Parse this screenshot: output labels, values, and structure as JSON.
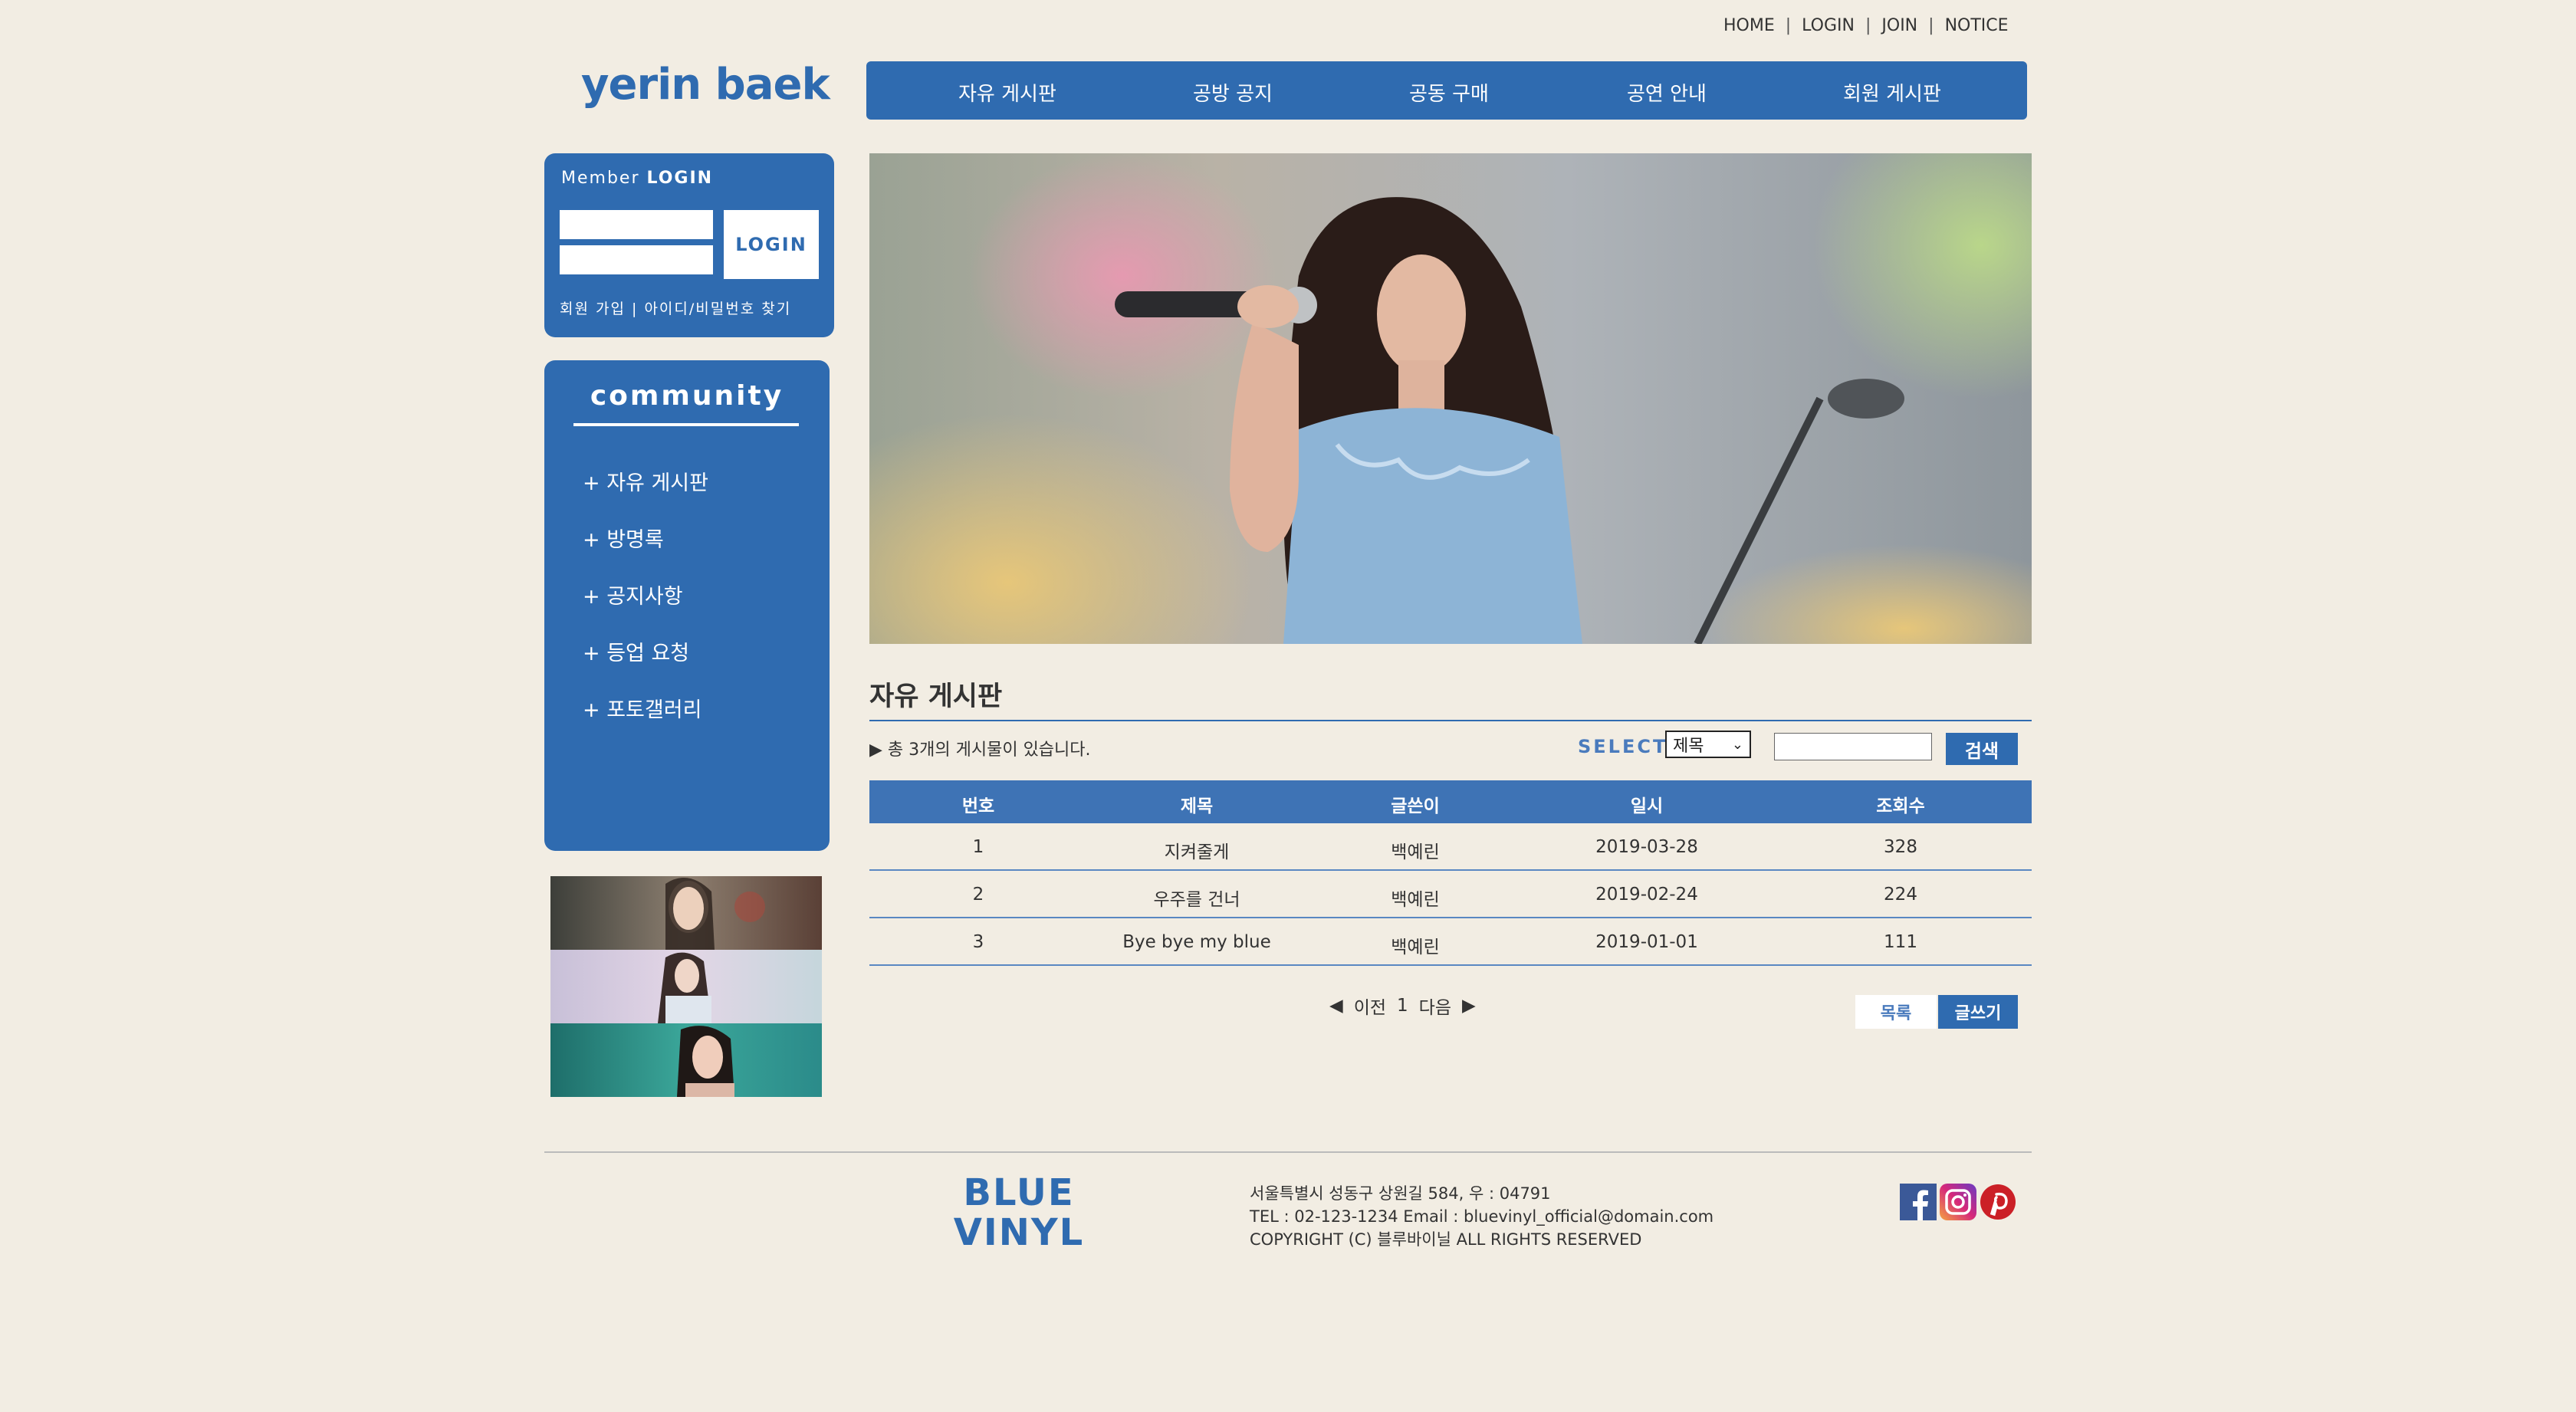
{
  "top_links": [
    "HOME",
    "LOGIN",
    "JOIN",
    "NOTICE"
  ],
  "logo": "yerin baek",
  "nav": [
    "자유 게시판",
    "공방 공지",
    "공동 구매",
    "공연 안내",
    "회원 게시판"
  ],
  "login": {
    "title_prefix": "Member",
    "title_bold": "LOGIN",
    "button": "LOGIN",
    "links": "회원 가입  |  아이디/비밀번호 찾기"
  },
  "community": {
    "title": "community",
    "items": [
      "+ 자유 게시판",
      "+ 방명록",
      "+ 공지사항",
      "+ 등업 요청",
      "+ 포토갤러리"
    ]
  },
  "board": {
    "title": "자유 게시판",
    "count_text": "▶ 총 3개의 게시물이 있습니다.",
    "select_label": "SELECT",
    "select_value": "제목",
    "search_button": "검색",
    "columns": [
      "번호",
      "제목",
      "글쓴이",
      "일시",
      "조회수"
    ],
    "rows": [
      [
        "1",
        "지켜줄게",
        "백예린",
        "2019-03-28",
        "328"
      ],
      [
        "2",
        "우주를 건너",
        "백예린",
        "2019-02-24",
        "224"
      ],
      [
        "3",
        "Bye bye my blue",
        "백예린",
        "2019-01-01",
        "111"
      ]
    ],
    "pager": {
      "prev": "이전",
      "page": "1",
      "next": "다음"
    },
    "list_button": "목록",
    "write_button": "글쓰기"
  },
  "footer": {
    "logo_line1": "BLUE",
    "logo_line2": "VINYL",
    "address": "서울특별시 성동구 상원길 584, 우 : 04791",
    "contact": "TEL : 02-123-1234 Email : bluevinyl_official@domain.com",
    "copyright": "COPYRIGHT (C) 블루바이닐 ALL RIGHTS RESERVED",
    "social_icons": [
      "facebook-icon",
      "instagram-icon",
      "pinterest-icon"
    ]
  },
  "colors": {
    "primary": "#2f6bb0",
    "background": "#f2ede3"
  }
}
